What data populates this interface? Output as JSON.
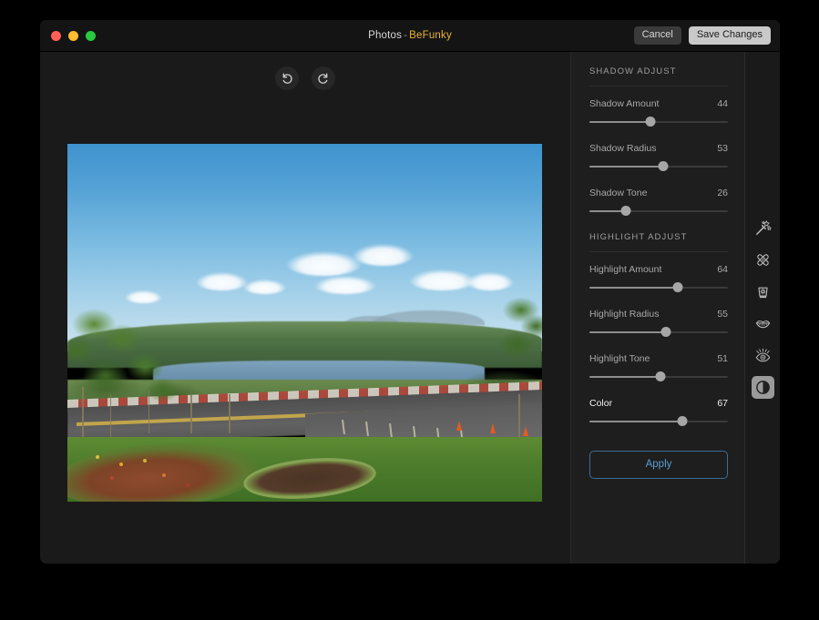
{
  "window": {
    "title_app": "Photos",
    "title_sep": "-",
    "title_brand": "BeFunky",
    "cancel_label": "Cancel",
    "save_label": "Save Changes",
    "brand_color": "#e8b338",
    "accent_color": "#5a9ed6"
  },
  "canvas": {
    "undo_label": "Undo",
    "redo_label": "Redo",
    "photo_alt": "Landscape photo of a lake with forest, distant mountains, a road with traffic cones, lawn and flower beds"
  },
  "panel": {
    "sections": [
      {
        "title": "SHADOW ADJUST",
        "controls": [
          {
            "label": "Shadow Amount",
            "value": "44",
            "percent": 44,
            "active": false
          },
          {
            "label": "Shadow Radius",
            "value": "53",
            "percent": 53,
            "active": false
          },
          {
            "label": "Shadow Tone",
            "value": "26",
            "percent": 26,
            "active": false
          }
        ]
      },
      {
        "title": "HIGHLIGHT ADJUST",
        "controls": [
          {
            "label": "Highlight Amount",
            "value": "64",
            "percent": 64,
            "active": false
          },
          {
            "label": "Highlight Radius",
            "value": "55",
            "percent": 55,
            "active": false
          },
          {
            "label": "Highlight Tone",
            "value": "51",
            "percent": 51,
            "active": false
          },
          {
            "label": "Color",
            "value": "67",
            "percent": 67,
            "active": true
          }
        ]
      }
    ],
    "apply_label": "Apply"
  },
  "rail": {
    "tools": [
      {
        "name": "magic-wand-icon",
        "label": "Touch Up",
        "selected": false
      },
      {
        "name": "blemish-fix-icon",
        "label": "Blemish Fix",
        "selected": false
      },
      {
        "name": "skin-smoother-icon",
        "label": "Skin Smoother",
        "selected": false
      },
      {
        "name": "lips-icon",
        "label": "Lips",
        "selected": false
      },
      {
        "name": "eyes-icon",
        "label": "Eyes",
        "selected": false
      },
      {
        "name": "contrast-icon",
        "label": "Shadows & Highlights",
        "selected": true
      }
    ]
  }
}
